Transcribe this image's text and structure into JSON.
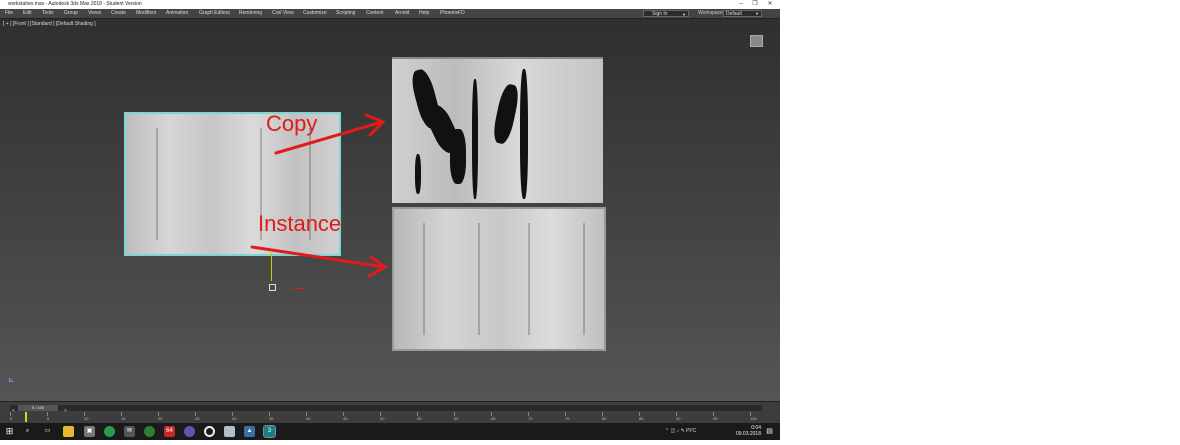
{
  "window": {
    "title": "workstation.max - Autodesk 3ds Max 2018 - Student Version",
    "controls": [
      "–",
      "❐",
      "✕"
    ]
  },
  "menu": {
    "items": [
      "File",
      "Edit",
      "Tools",
      "Group",
      "Views",
      "Create",
      "Modifiers",
      "Animation",
      "Graph Editors",
      "Rendering",
      "Civil View",
      "Customize",
      "Scripting",
      "Content",
      "Arnold",
      "Help",
      "PhoenixFD"
    ],
    "signin": "Sign In",
    "workspaces_label": "Workspaces:",
    "workspace_value": "Default"
  },
  "viewport": {
    "label": "[ + ] [Front ] [Standard ] [Default Shading ]"
  },
  "annotations": {
    "copy": "Copy",
    "instance": "Instance",
    "color": "#e01b1b"
  },
  "timeline": {
    "frame_counter": "0 / 100",
    "prev": "<",
    "next": ">",
    "ticks": [
      "0",
      "5",
      "10",
      "15",
      "20",
      "25",
      "30",
      "35",
      "40",
      "45",
      "50",
      "55",
      "60",
      "65",
      "70",
      "75",
      "80",
      "85",
      "90",
      "95",
      "100"
    ]
  },
  "taskbar": {
    "tray_lang": "РУС",
    "time": "0:04",
    "date": "09.03.2018",
    "apps": [
      "search-icon",
      "task-view-icon",
      "file-explorer-icon",
      "store-icon",
      "chrome-icon",
      "mail-icon",
      "app-green-icon",
      "app-64-icon",
      "viber-icon",
      "app-circle-icon",
      "notepad-icon",
      "photos-icon",
      "3dsmax-icon"
    ]
  }
}
